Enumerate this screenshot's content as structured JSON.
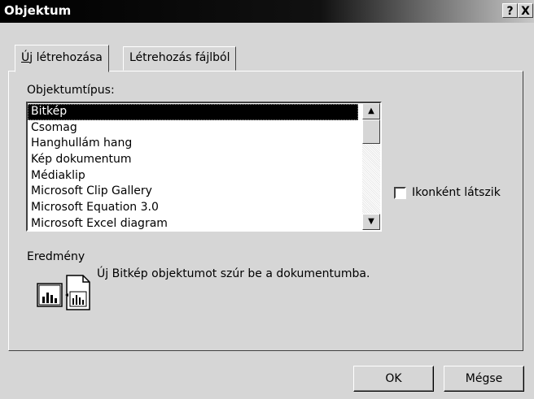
{
  "window": {
    "title": "Objektum",
    "help_label": "?",
    "close_label": "X"
  },
  "tabs": [
    {
      "label": "Új létrehozása",
      "active": true
    },
    {
      "label": "Létrehozás fájlból",
      "active": false
    }
  ],
  "object_type": {
    "label": "Objektumtípus:",
    "items": [
      "Bitkép",
      "Csomag",
      "Hanghullám hang",
      "Kép dokumentum",
      "Médiaklip",
      "Microsoft Clip Gallery",
      "Microsoft Equation 3.0",
      "Microsoft Excel diagram"
    ],
    "selected": "Bitkép",
    "scroll_up_icon": "arrow-up-icon",
    "scroll_down_icon": "arrow-down-icon"
  },
  "display_as_icon": {
    "label": "Ikonként látszik",
    "checked": false
  },
  "result": {
    "label": "Eredmény",
    "text": "Új Bitkép objektumot szúr be a dokumentumba.",
    "icon": "insert-object-icon"
  },
  "buttons": {
    "ok_label": "OK",
    "cancel_label": "Mégse"
  },
  "colors": {
    "title_bar": "#000000",
    "face": "#d6d6d6",
    "selection": "#000000"
  }
}
